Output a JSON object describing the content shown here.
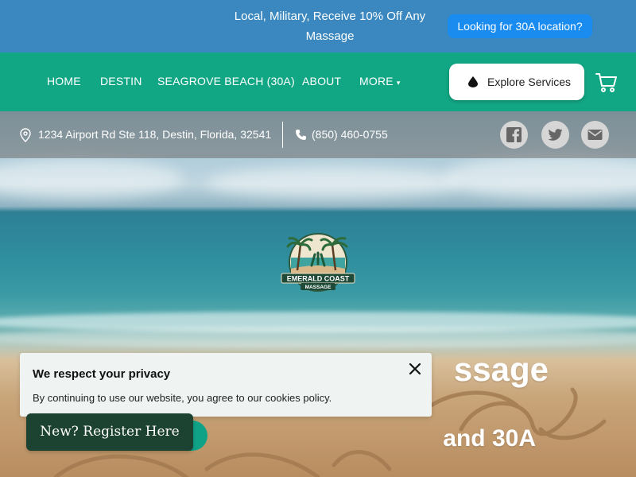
{
  "promo": {
    "text": "Local, Military, Receive 10% Off Any Massage",
    "button_label": "Looking for 30A location?"
  },
  "nav": {
    "items": [
      {
        "label": "HOME"
      },
      {
        "label": "DESTIN"
      },
      {
        "label": "SEAGROVE BEACH (30A)"
      },
      {
        "label": "ABOUT"
      },
      {
        "label": "MORE"
      }
    ],
    "explore_label": "Explore Services",
    "cart_icon": "cart-icon"
  },
  "info_bar": {
    "address": "1234 Airport Rd Ste 118, Destin, Florida, 32541",
    "phone": "(850) 460-0755",
    "social": [
      "facebook-icon",
      "twitter-icon",
      "email-icon"
    ]
  },
  "hero": {
    "logo_line1": "EMERALD COAST",
    "logo_line2": "MASSAGE",
    "title_visible": "ssage",
    "subtitle_visible": "and 30A"
  },
  "cookie_banner": {
    "title": "We respect your privacy",
    "text": "By continuing to use our website, you agree to our cookies policy."
  },
  "register": {
    "label": "New? Register Here"
  },
  "colors": {
    "promo_bg": "#3a88bf",
    "promo_button": "#1a8cf0",
    "nav_bg": "#12a784",
    "register_bg": "#1c4231",
    "cookie_bg": "#eff4f2"
  }
}
